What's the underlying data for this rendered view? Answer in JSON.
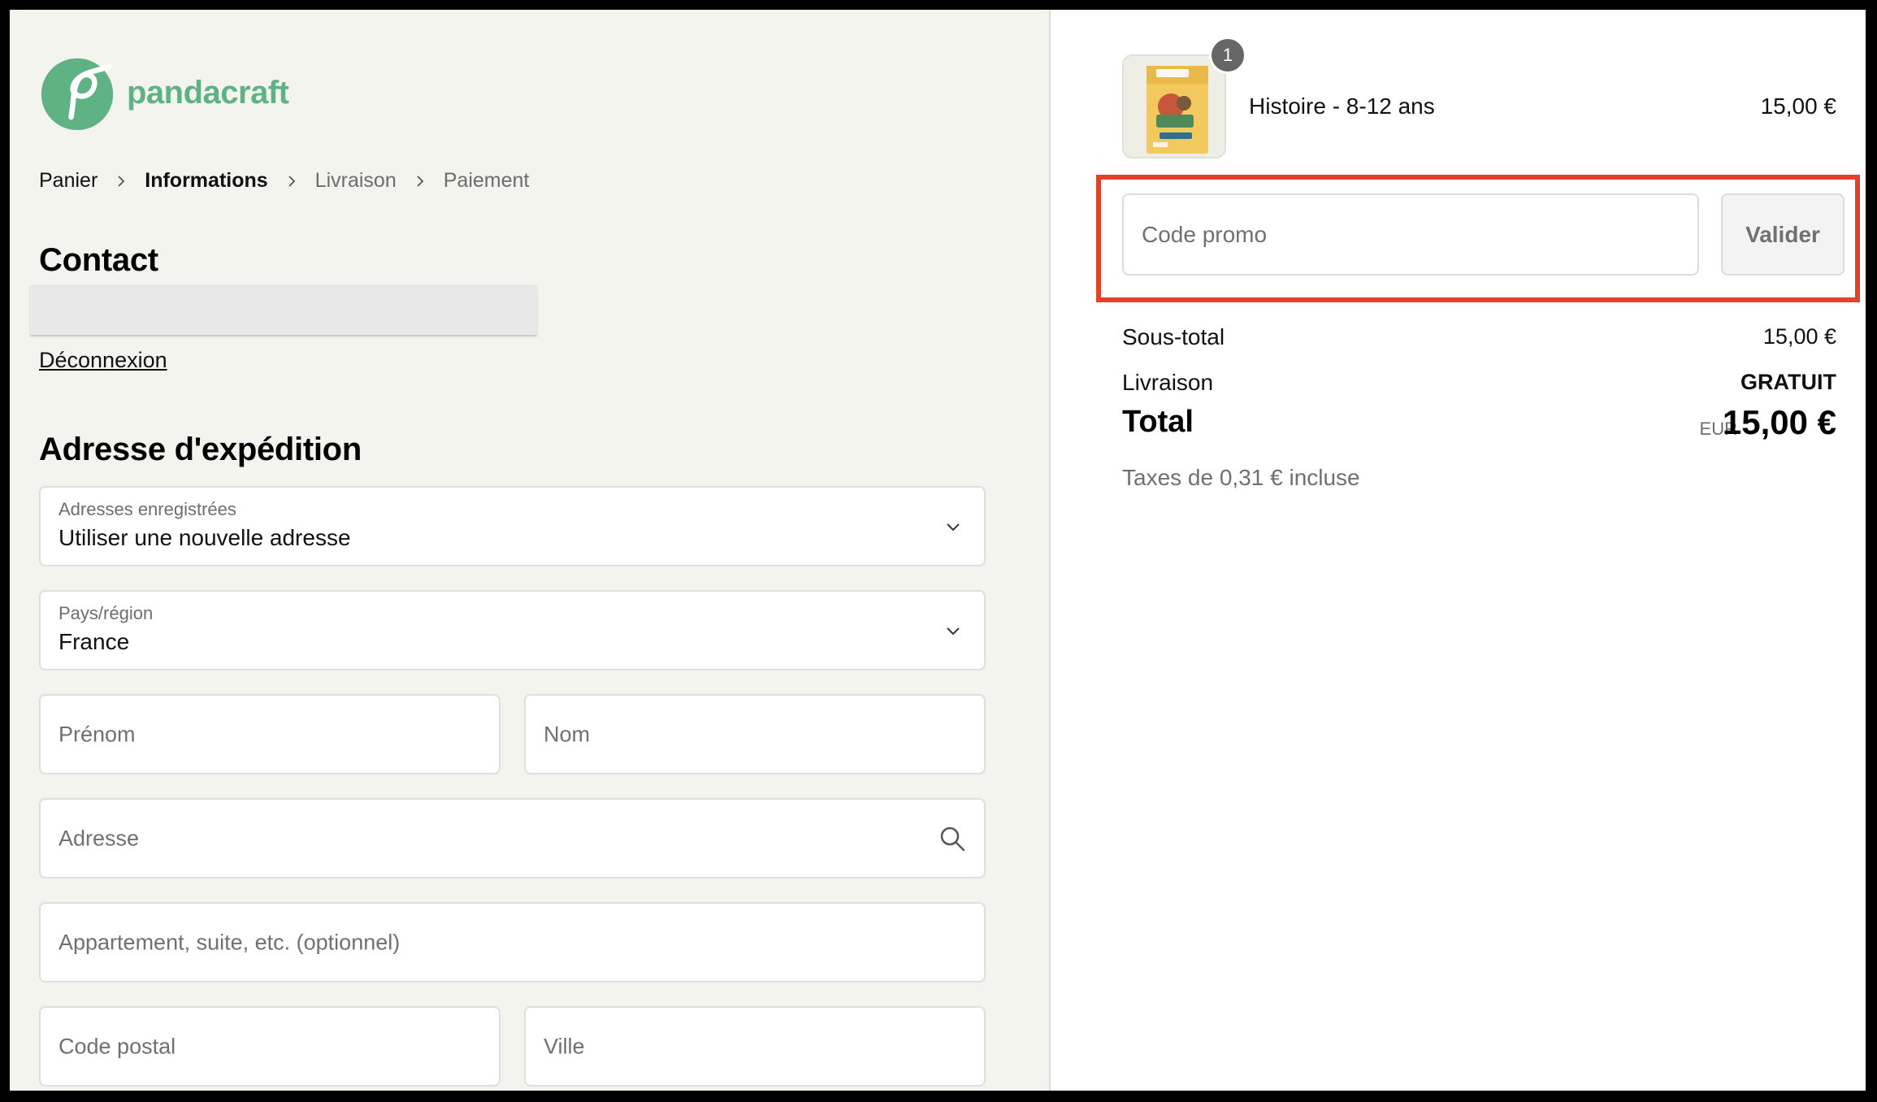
{
  "brand": {
    "name": "pandacraft",
    "color": "#5eb283"
  },
  "breadcrumb": [
    "Panier",
    "Informations",
    "Livraison",
    "Paiement"
  ],
  "contact": {
    "title": "Contact",
    "logout_label": "Déconnexion"
  },
  "shipping": {
    "title": "Adresse d'expédition",
    "saved_addresses": {
      "label": "Adresses enregistrées",
      "value": "Utiliser une nouvelle adresse"
    },
    "country": {
      "label": "Pays/région",
      "value": "France"
    },
    "first_name_placeholder": "Prénom",
    "last_name_placeholder": "Nom",
    "address_placeholder": "Adresse",
    "apartment_placeholder": "Appartement, suite, etc. (optionnel)",
    "postal_code_placeholder": "Code postal",
    "city_placeholder": "Ville"
  },
  "cart": {
    "item": {
      "name": "Histoire - 8-12 ans",
      "price": "15,00 €",
      "quantity": "1"
    },
    "promo": {
      "placeholder": "Code promo",
      "button_label": "Valider"
    },
    "subtotal": {
      "label": "Sous-total",
      "value": "15,00 €"
    },
    "shipping": {
      "label": "Livraison",
      "value": "GRATUIT"
    },
    "total": {
      "label": "Total",
      "currency": "EUR",
      "value": "15,00 €"
    },
    "taxes_note": "Taxes de 0,31 € incluse"
  },
  "colors": {
    "highlight": "#e4402b",
    "left_background": "#f4f4ef",
    "right_background": "#ffffff"
  }
}
